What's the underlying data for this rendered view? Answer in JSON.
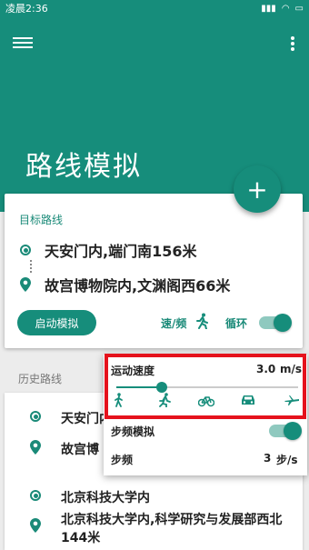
{
  "status": {
    "time": "凌晨2:36"
  },
  "header": {
    "title": "路线模拟",
    "fab_label": "+"
  },
  "target_card": {
    "title": "目标路线",
    "origin": "天安门内,端门南156米",
    "destination": "故宫博物院内,文渊阁西66米",
    "start_button": "启动模拟",
    "speed_mode_label": "速/频",
    "loop_label": "循环",
    "loop_on": true
  },
  "history": {
    "label": "历史路线",
    "items": [
      {
        "origin": "天安门内",
        "destination": "故宫博"
      },
      {
        "origin": "北京科技大学内",
        "destination": "北京科技大学内,科学研究与发展部西北144米"
      }
    ]
  },
  "speed_popup": {
    "speed_label": "运动速度",
    "speed_value": "3.0",
    "speed_unit": "m/s",
    "slider_fraction": 0.25,
    "modes": [
      "walk-icon",
      "run-icon",
      "bike-icon",
      "car-icon",
      "plane-icon"
    ],
    "step_sim_label": "步频模拟",
    "step_sim_on": true,
    "step_rate_label": "步频",
    "step_rate_value": "3",
    "step_rate_unit": "步/s"
  },
  "colors": {
    "primary": "#168d7b",
    "highlight": "#e5121c"
  }
}
